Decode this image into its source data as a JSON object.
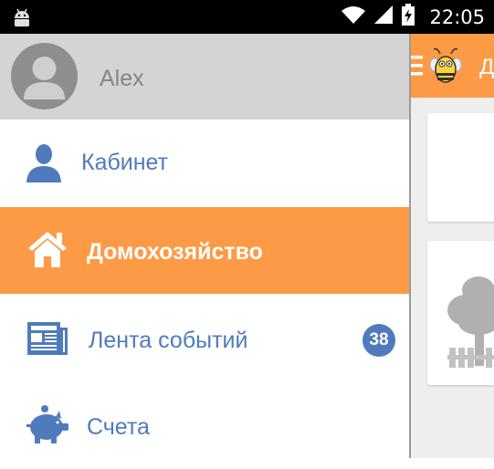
{
  "status_bar": {
    "time": "22:05",
    "icons": [
      "android-icon",
      "wifi-icon",
      "signal-icon",
      "battery-charging-icon"
    ],
    "text_color": "#ffffff",
    "background": "#000000"
  },
  "drawer": {
    "user": {
      "name": "Alex",
      "avatar_icon": "avatar-icon"
    },
    "items": [
      {
        "label": "Кабинет",
        "icon": "person-icon",
        "active": false
      },
      {
        "label": "Домохозяйство",
        "icon": "home-icon",
        "active": true
      },
      {
        "label": "Лента событий",
        "icon": "newspaper-icon",
        "active": false,
        "badge": "38"
      },
      {
        "label": "Счета",
        "icon": "piggy-bank-icon",
        "active": false
      }
    ]
  },
  "app_bar": {
    "title": "Д",
    "icons": [
      "menu-icon",
      "bee-logo-icon"
    ]
  },
  "colors": {
    "accent": "#fd9a45",
    "nav_text": "#4f7bbd",
    "badge": "#4f7bbd",
    "profile_background": "#d4d4d4"
  }
}
